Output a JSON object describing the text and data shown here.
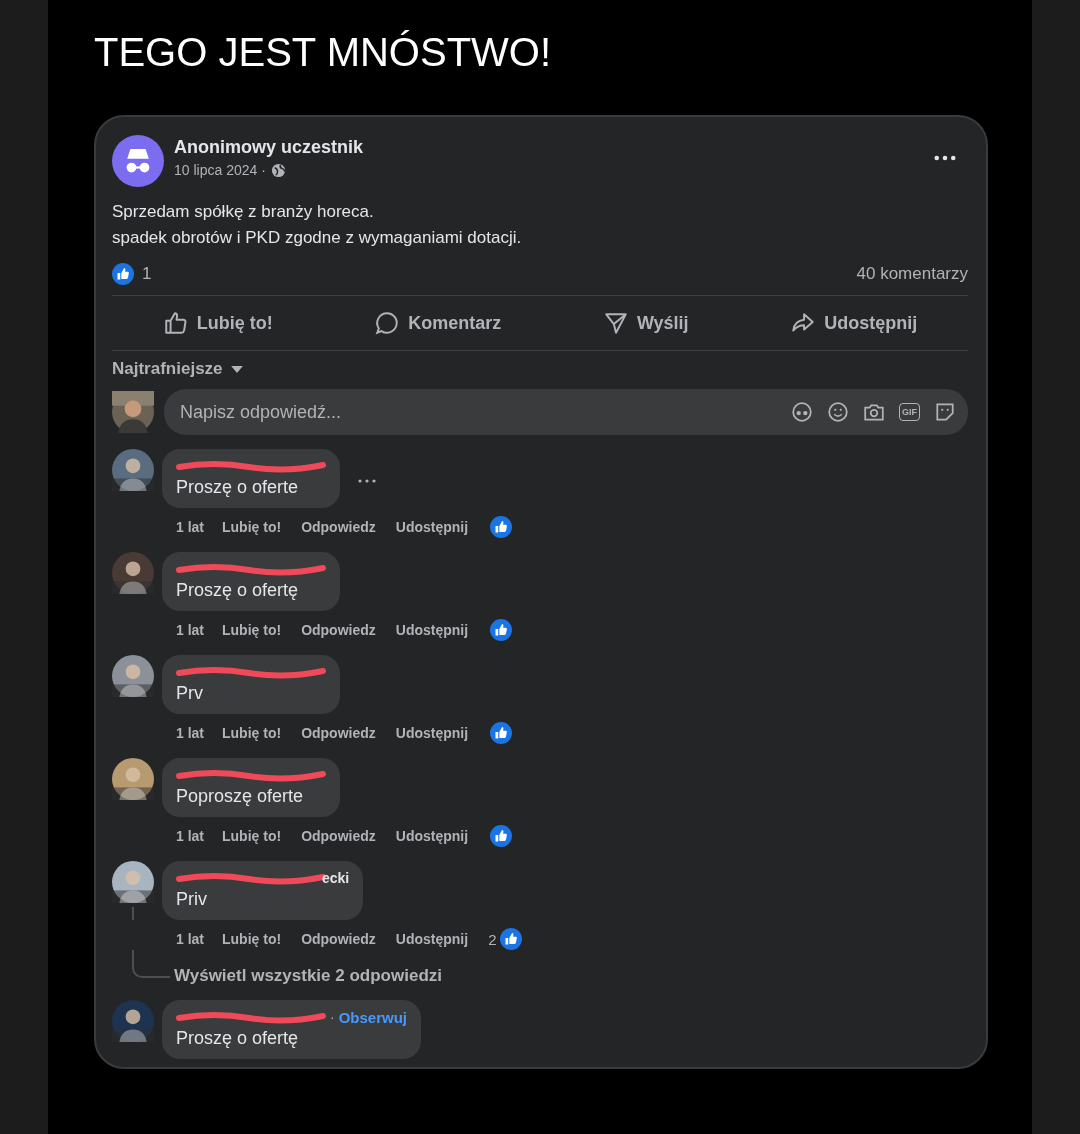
{
  "heading": "TEGO JEST MNÓSTWO!",
  "post": {
    "author": "Anonimowy uczestnik",
    "date": "10 lipca 2024 ·",
    "lines": [
      "Sprzedam spółkę z branży horeca.",
      "spadek obrotów i PKD zgodne z wymaganiami dotacji."
    ],
    "like_count": "1",
    "comment_count": "40 komentarzy",
    "actions": [
      {
        "kind": "like",
        "label": "Lubię to!"
      },
      {
        "kind": "comment",
        "label": "Komentarz"
      },
      {
        "kind": "send",
        "label": "Wyślij"
      },
      {
        "kind": "share",
        "label": "Udostępnij"
      }
    ]
  },
  "sort": "Najtrafniejsze",
  "composer": {
    "placeholder": "Napisz odpowiedź...",
    "gif_label": "GIF"
  },
  "comments": [
    {
      "text": "Proszę o oferte",
      "menu": true,
      "time": "1 lat",
      "actions": [
        "Lubię to!",
        "Odpowiedz",
        "Udostępnij"
      ]
    },
    {
      "text": "Proszę o ofertę",
      "menu": false,
      "time": "1 lat",
      "actions": [
        "Lubię to!",
        "Odpowiedz",
        "Udostępnij"
      ]
    },
    {
      "text": "Prv",
      "menu": false,
      "time": "1 lat",
      "actions": [
        "Lubię to!",
        "Odpowiedz",
        "Udostępnij"
      ]
    },
    {
      "text": "Poproszę oferte",
      "menu": false,
      "time": "1 lat",
      "actions": [
        "Lubię to!",
        "Odpowiedz",
        "Udostępnij"
      ]
    },
    {
      "text": "Priv",
      "name_tail": "ecki",
      "menu": false,
      "time": "1 lat",
      "actions": [
        "Lubię to!",
        "Odpowiedz",
        "Udostępnij"
      ],
      "reaction_count": "2",
      "replies": "Wyświetl wszystkie 2 odpowiedzi"
    },
    {
      "text": "Proszę o ofertę",
      "follow": {
        "separator": "·",
        "label": "Obserwuj"
      },
      "menu": false
    }
  ]
}
